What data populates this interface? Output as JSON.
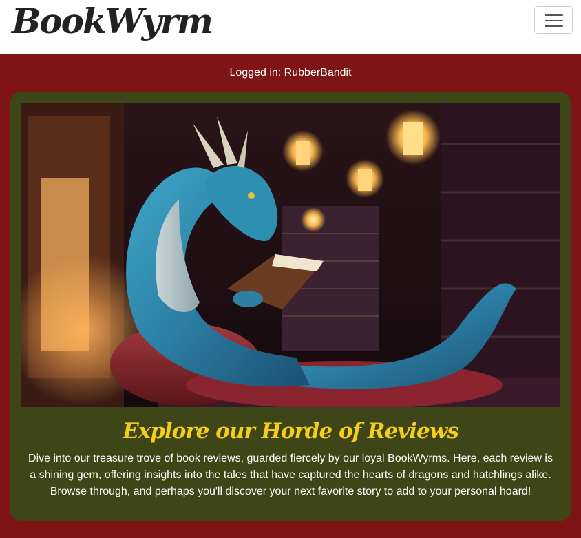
{
  "navbar": {
    "brand": "BookWyrm",
    "toggle_icon": "hamburger-menu-icon"
  },
  "user": {
    "status": "Logged in: RubberBandit"
  },
  "hero_card": {
    "image_icon": "dragon-reading-in-library-illustration",
    "title": "Explore our Horde of Reviews",
    "body": "Dive into our treasure trove of book reviews, guarded fiercely by our loyal BookWyrms. Here, each review is a shining gem, offering insights into the tales that have captured the hearts of dragons and hatchlings alike. Browse through, and perhaps you'll discover your next favorite story to add to your personal hoard!"
  },
  "colors": {
    "page_background": "#7e1416",
    "card_background": "#3e4618",
    "title_accent": "#f5cd1b",
    "navbar_background": "#ffffff"
  }
}
